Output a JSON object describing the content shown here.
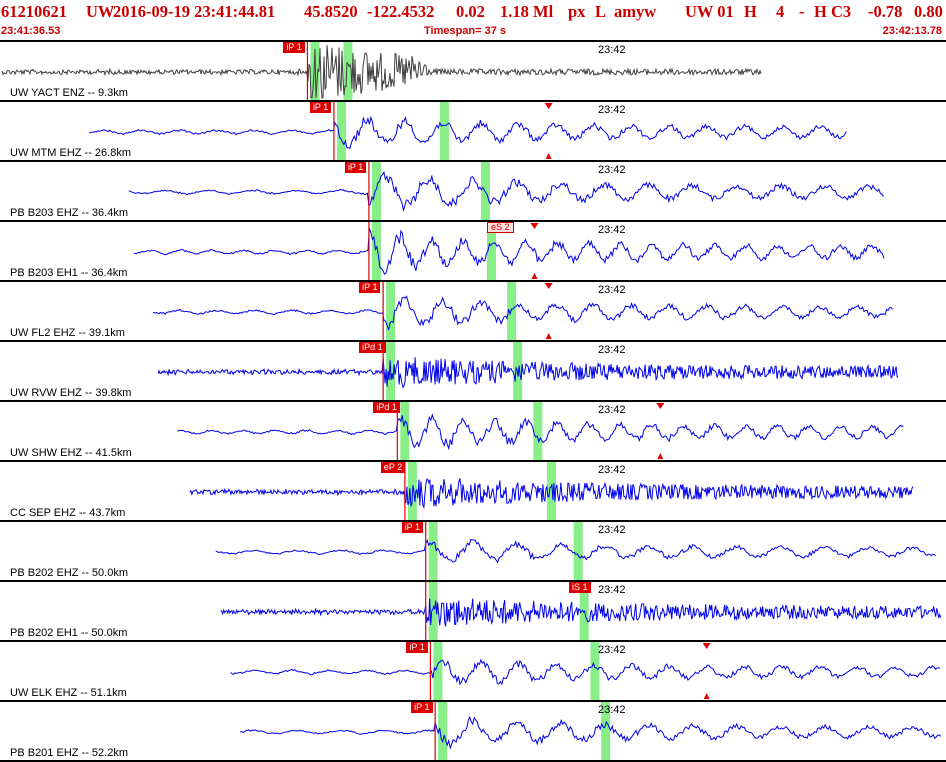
{
  "header": {
    "event_id": "61210621",
    "network": "UW",
    "datetime": "2016-09-19 23:41:44.81",
    "latitude": "45.8520",
    "longitude": "-122.4532",
    "depth": "0.02",
    "magnitude": "1.18 Ml",
    "etype": "px",
    "gtype": "L",
    "auth": "amyw",
    "src": "UW 01",
    "flag_h": "H",
    "nphases": "4",
    "dash": "-",
    "quality": "H C3",
    "val1": "-0.78",
    "val2": "0.80",
    "start_time": "23:41:36.53",
    "timespan": "Timespan=  37 s",
    "end_time": "23:42:13.78"
  },
  "colors": {
    "header_text": "#cc0000",
    "trace_first": "#404040",
    "trace": "#0000ee",
    "pick": "#dd0000",
    "phase_band": "#88ee88",
    "separator": "#000000"
  },
  "time_marker": "23:42",
  "traces": [
    {
      "label": "UW YACT ENZ -- 9.3km",
      "picks": [
        {
          "text": "iP 1",
          "style": "solid"
        }
      ],
      "onset": 0.325,
      "end": 0.805,
      "amp": 1.0,
      "freq": "high",
      "mute": true
    },
    {
      "label": "UW MTM EHZ -- 26.8km",
      "picks": [
        {
          "text": "iP 1",
          "style": "solid"
        }
      ],
      "onset": 0.353,
      "end": 0.895,
      "amp": 0.6,
      "freq": "mid",
      "triangle": 0.58
    },
    {
      "label": "PB B203 EHZ -- 36.4km",
      "picks": [
        {
          "text": "iP 1",
          "style": "solid"
        }
      ],
      "onset": 0.39,
      "end": 0.935,
      "amp": 0.7,
      "freq": "mid"
    },
    {
      "label": "PB B203 EH1 -- 36.4km",
      "picks": [
        {
          "text": "eS 2",
          "style": "hollow"
        }
      ],
      "onset": 0.39,
      "end": 0.935,
      "amp": 0.75,
      "freq": "mid",
      "triangle": 0.565
    },
    {
      "label": "UW FL2 EHZ -- 39.1km",
      "picks": [
        {
          "text": "iP 1",
          "style": "solid"
        }
      ],
      "onset": 0.405,
      "end": 0.945,
      "amp": 0.6,
      "freq": "mid",
      "triangle": 0.58
    },
    {
      "label": "UW RVW EHZ -- 39.8km",
      "picks": [
        {
          "text": "iPd 1",
          "style": "solid"
        }
      ],
      "onset": 0.405,
      "end": 0.95,
      "amp": 0.5,
      "freq": "high"
    },
    {
      "label": "UW SHW EHZ -- 41.5km",
      "picks": [
        {
          "text": "iPd 1",
          "style": "solid"
        }
      ],
      "onset": 0.42,
      "end": 0.955,
      "amp": 0.65,
      "freq": "mid",
      "triangle": 0.698
    },
    {
      "label": "CC SEP EHZ -- 43.7km",
      "picks": [
        {
          "text": "eP 2",
          "style": "solid"
        }
      ],
      "onset": 0.428,
      "end": 0.965,
      "amp": 0.5,
      "freq": "high"
    },
    {
      "label": "PB B202 EHZ -- 50.0km",
      "picks": [
        {
          "text": "iP 1",
          "style": "solid"
        }
      ],
      "onset": 0.45,
      "end": 0.99,
      "amp": 0.45,
      "freq": "mid"
    },
    {
      "label": "PB B202 EH1 -- 50.0km",
      "picks": [
        {
          "text": "iS 1",
          "style": "solid"
        }
      ],
      "onset": 0.45,
      "end": 0.995,
      "amp": 0.5,
      "freq": "high"
    },
    {
      "label": "UW ELK EHZ -- 51.1km",
      "picks": [
        {
          "text": "iP 1",
          "style": "solid"
        }
      ],
      "onset": 0.455,
      "end": 0.995,
      "amp": 0.5,
      "freq": "mid",
      "triangle": 0.747
    },
    {
      "label": "PB B201 EHZ -- 52.2km",
      "picks": [
        {
          "text": "iP 1",
          "style": "solid"
        }
      ],
      "onset": 0.46,
      "end": 0.995,
      "amp": 0.55,
      "freq": "mid"
    }
  ]
}
